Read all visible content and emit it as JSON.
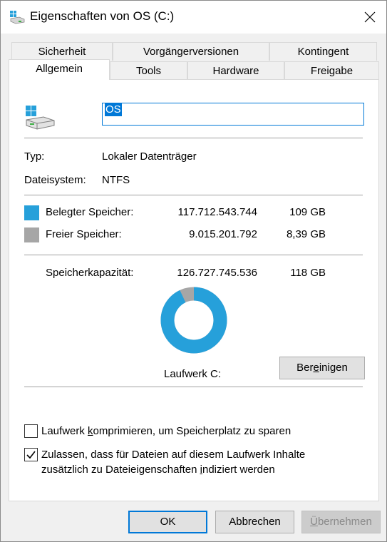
{
  "window": {
    "title": "Eigenschaften von OS (C:)"
  },
  "tabs": {
    "row1": [
      "Sicherheit",
      "Vorgängerversionen",
      "Kontingent"
    ],
    "row2": [
      "Allgemein",
      "Tools",
      "Hardware",
      "Freigabe"
    ],
    "active": "Allgemein"
  },
  "general": {
    "drive_name": "OS",
    "type_label": "Typ:",
    "type_value": "Lokaler Datenträger",
    "fs_label": "Dateisystem:",
    "fs_value": "NTFS",
    "used": {
      "label": "Belegter Speicher:",
      "bytes": "117.712.543.744",
      "size": "109 GB",
      "color": "#26a0da"
    },
    "free": {
      "label": "Freier Speicher:",
      "bytes": "9.015.201.792",
      "size": "8,39 GB",
      "color": "#a6a6a6"
    },
    "capacity": {
      "label": "Speicherkapazität:",
      "bytes": "126.727.745.536",
      "size": "118 GB"
    },
    "drive_label": "Laufwerk C:",
    "cleanup_button": {
      "pre": "Ber",
      "accel": "e",
      "post": "inigen"
    },
    "compress": {
      "pre": "Laufwerk ",
      "accel": "k",
      "post": "omprimieren, um Speicherplatz zu sparen",
      "checked": false
    },
    "index": {
      "line1": "Zulassen, dass für Dateien auf diesem Laufwerk Inhalte",
      "line2_pre": "zusätzlich zu Dateieigenschaften ",
      "accel": "i",
      "line2_post": "ndiziert werden",
      "checked": true
    }
  },
  "usage_chart": {
    "used_fraction": 0.9289,
    "free_fraction": 0.0711
  },
  "footer": {
    "ok": "OK",
    "cancel": "Abbrechen",
    "apply": {
      "accel": "Ü",
      "post": "bernehmen"
    }
  }
}
